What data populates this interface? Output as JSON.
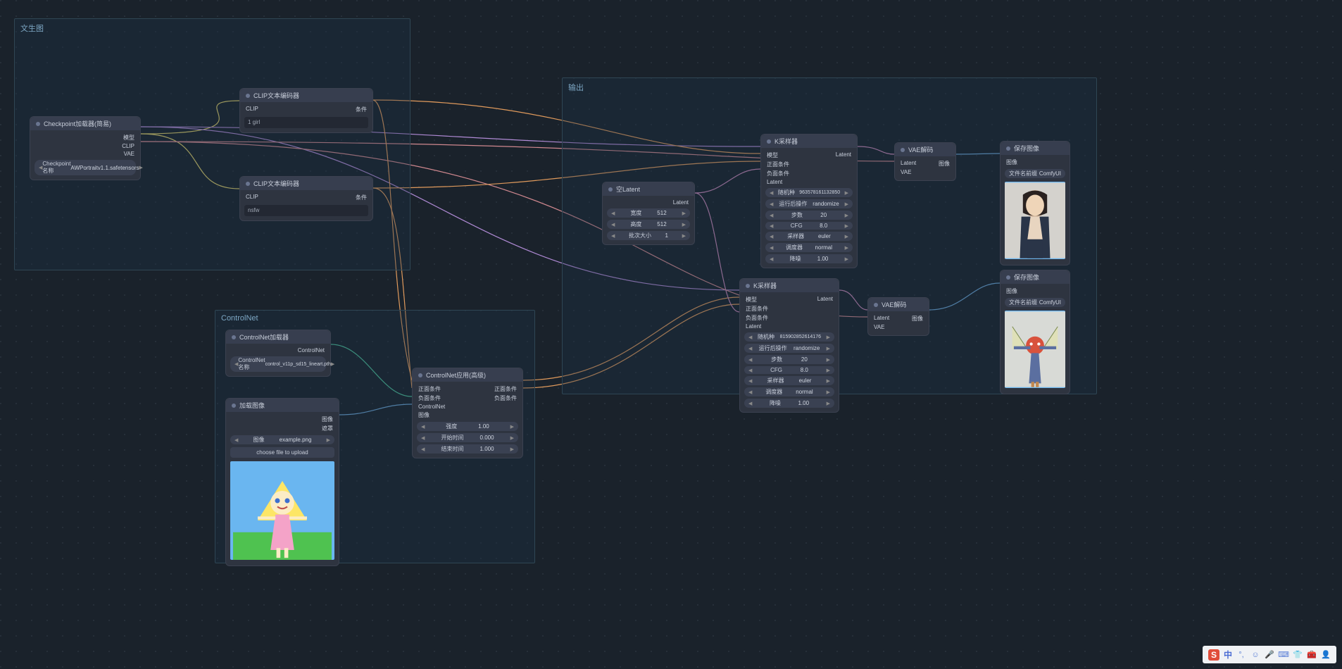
{
  "groups": {
    "g1_title": "文生图",
    "g2_title": "ControlNet",
    "g3_title": "输出"
  },
  "nodes": {
    "ckpt": {
      "title": "Checkpoint加载器(简易)",
      "out1": "模型",
      "out2": "CLIP",
      "out3": "VAE",
      "field_label": "Checkpoint名称",
      "field_value": "AWPortraitv1.1.safetensors"
    },
    "clip1": {
      "title": "CLIP文本编码器",
      "in1": "CLIP",
      "out1": "条件",
      "text": "1 girl"
    },
    "clip2": {
      "title": "CLIP文本编码器",
      "in1": "CLIP",
      "out1": "条件",
      "text": "nsfw"
    },
    "cnloader": {
      "title": "ControlNet加载器",
      "out1": "ControlNet",
      "field_label": "ControlNet名称",
      "field_value": "control_v11p_sd15_lineart.pth"
    },
    "loadimg": {
      "title": "加载图像",
      "out1": "图像",
      "out2": "遮罩",
      "field_label": "图像",
      "field_value": "example.png",
      "upload": "choose file to upload"
    },
    "cnapply": {
      "title": "ControlNet应用(高级)",
      "in1": "正面条件",
      "in2": "负面条件",
      "in3": "ControlNet",
      "in4": "图像",
      "out1": "正面条件",
      "out2": "负面条件",
      "f1_label": "强度",
      "f1_val": "1.00",
      "f2_label": "开始时间",
      "f2_val": "0.000",
      "f3_label": "结束时间",
      "f3_val": "1.000"
    },
    "empty": {
      "title": "空Latent",
      "out1": "Latent",
      "f1_label": "宽度",
      "f1_val": "512",
      "f2_label": "高度",
      "f2_val": "512",
      "f3_label": "批次大小",
      "f3_val": "1"
    },
    "ks1": {
      "title": "K采样器",
      "in1": "模型",
      "in2": "正面条件",
      "in3": "负面条件",
      "in4": "Latent",
      "out1": "Latent",
      "f1_label": "随机种",
      "f1_val": "963578161132850",
      "f2_label": "运行后操作",
      "f2_val": "randomize",
      "f3_label": "步数",
      "f3_val": "20",
      "f4_label": "CFG",
      "f4_val": "8.0",
      "f5_label": "采样器",
      "f5_val": "euler",
      "f6_label": "调度器",
      "f6_val": "normal",
      "f7_label": "降噪",
      "f7_val": "1.00"
    },
    "ks2": {
      "title": "K采样器",
      "in1": "模型",
      "in2": "正面条件",
      "in3": "负面条件",
      "in4": "Latent",
      "out1": "Latent",
      "f1_label": "随机种",
      "f1_val": "815902852614176",
      "f2_label": "运行后操作",
      "f2_val": "randomize",
      "f3_label": "步数",
      "f3_val": "20",
      "f4_label": "CFG",
      "f4_val": "8.0",
      "f5_label": "采样器",
      "f5_val": "euler",
      "f6_label": "调度器",
      "f6_val": "normal",
      "f7_label": "降噪",
      "f7_val": "1.00"
    },
    "vae1": {
      "title": "VAE解码",
      "in1": "Latent",
      "in2": "VAE",
      "out1": "图像"
    },
    "vae2": {
      "title": "VAE解码",
      "in1": "Latent",
      "in2": "VAE",
      "out1": "图像"
    },
    "save1": {
      "title": "保存图像",
      "in1": "图像",
      "f1_label": "文件名前缀",
      "f1_val": "ComfyUI"
    },
    "save2": {
      "title": "保存图像",
      "in1": "图像",
      "f1_label": "文件名前缀",
      "f1_val": "ComfyUI"
    }
  },
  "ime": {
    "label": "中"
  }
}
